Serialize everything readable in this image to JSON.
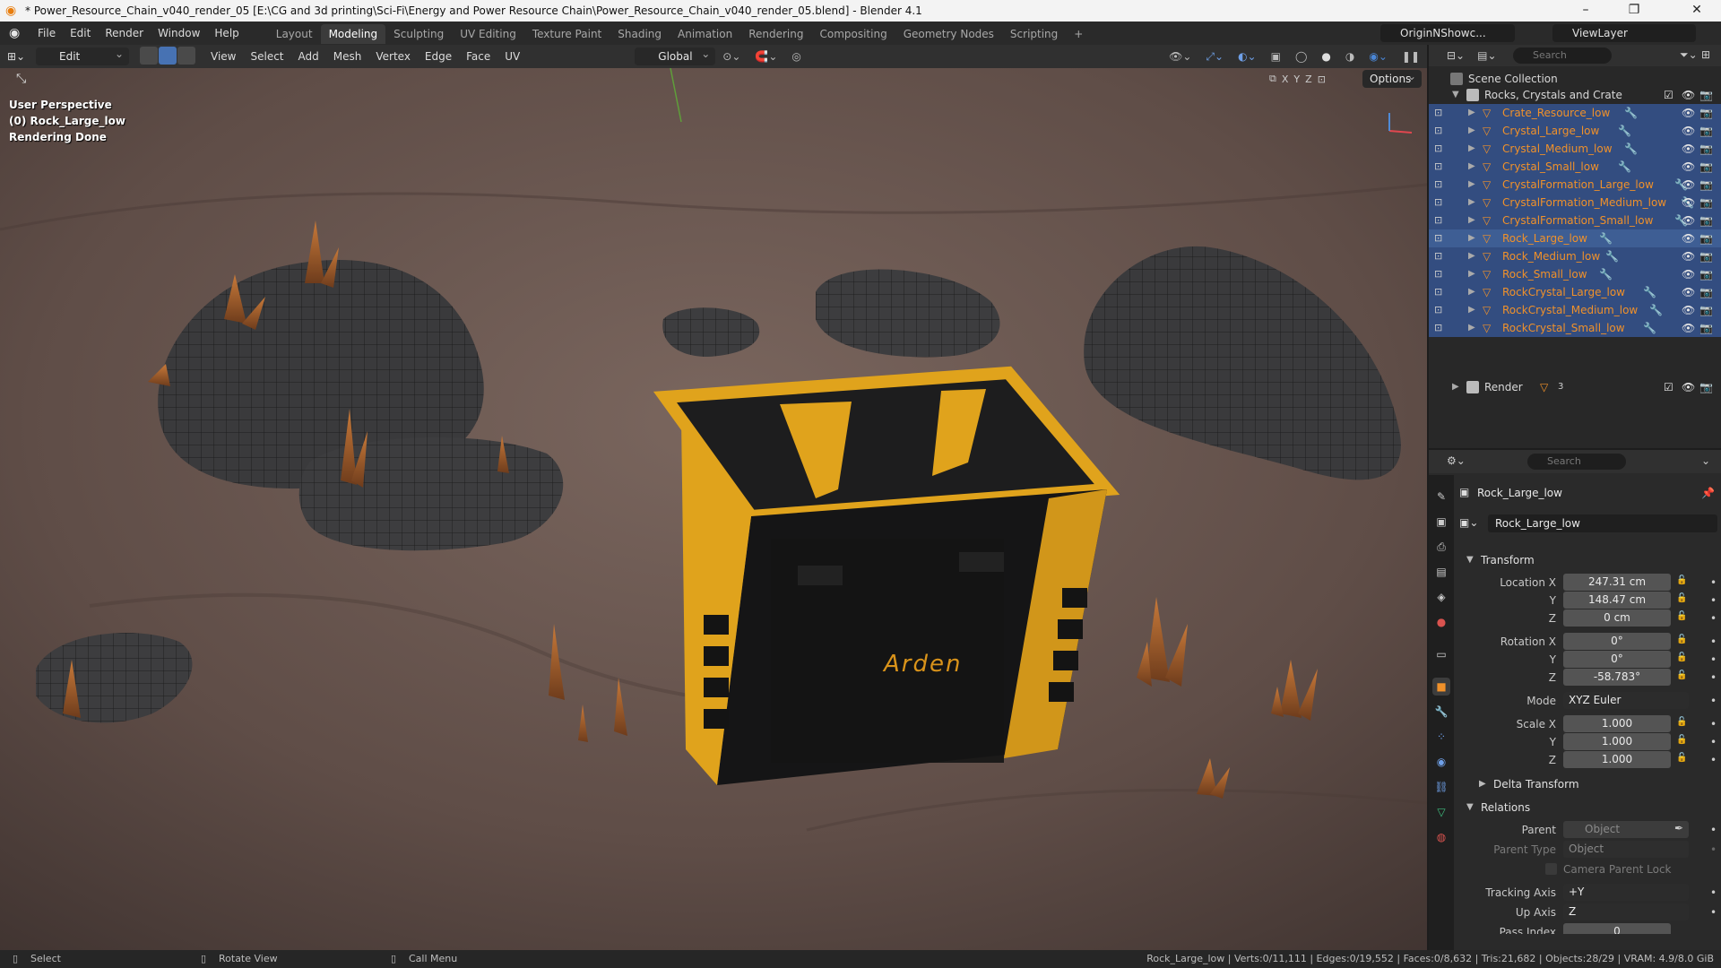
{
  "titlebar": {
    "title": "* Power_Resource_Chain_v040_render_05 [E:\\CG and 3d printing\\Sci-Fi\\Energy and Power Resource Chain\\Power_Resource_Chain_v040_render_05.blend] - Blender 4.1",
    "minimize": "–",
    "maximize": "❐",
    "close": "✕"
  },
  "menus": [
    "File",
    "Edit",
    "Render",
    "Window",
    "Help"
  ],
  "workspaces": [
    "Layout",
    "Modeling",
    "Sculpting",
    "UV Editing",
    "Texture Paint",
    "Shading",
    "Animation",
    "Rendering",
    "Compositing",
    "Geometry Nodes",
    "Scripting",
    "+"
  ],
  "active_workspace": "Modeling",
  "scene_name": "OriginNShowc...",
  "view_layer": "ViewLayer",
  "viewport_header": {
    "mode": "Edit Mode",
    "menus": [
      "View",
      "Select",
      "Add",
      "Mesh",
      "Vertex",
      "Edge",
      "Face",
      "UV"
    ],
    "transform_orientation": "Global",
    "options": "Options",
    "axes": [
      "X",
      "Y",
      "Z"
    ]
  },
  "viewport_info": {
    "perspective": "User Perspective",
    "object": "(0) Rock_Large_low",
    "status": "Rendering Done",
    "crate_logo": "Arden"
  },
  "outliner": {
    "search_placeholder": "Search",
    "scene_collection": "Scene Collection",
    "collection": "Rocks, Crystals and Crate",
    "objects": [
      "Crate_Resource_low",
      "Crystal_Large_low",
      "Crystal_Medium_low",
      "Crystal_Small_low",
      "CrystalFormation_Large_low",
      "CrystalFormation_Medium_low",
      "CrystalFormation_Small_low",
      "Rock_Large_low",
      "Rock_Medium_low",
      "Rock_Small_low",
      "RockCrystal_Large_low",
      "RockCrystal_Medium_low",
      "RockCrystal_Small_low"
    ],
    "active_object": "Rock_Large_low",
    "render_collection": "Render",
    "render_count": "3"
  },
  "properties": {
    "search_placeholder": "Search",
    "object_name": "Rock_Large_low",
    "name_field": "Rock_Large_low",
    "transform_label": "Transform",
    "location_label": "Location X",
    "location": [
      "247.31 cm",
      "148.47 cm",
      "0 cm"
    ],
    "rotation_label": "Rotation X",
    "rotation": [
      "0°",
      "0°",
      "-58.783°"
    ],
    "mode_label": "Mode",
    "mode": "XYZ Euler",
    "scale_label": "Scale X",
    "scale": [
      "1.000",
      "1.000",
      "1.000"
    ],
    "axis_y": "Y",
    "axis_z": "Z",
    "delta_transform": "Delta Transform",
    "relations": "Relations",
    "parent_label": "Parent",
    "parent_placeholder": "Object",
    "parent_type_label": "Parent Type",
    "parent_type": "Object",
    "camera_parent_lock": "Camera Parent Lock",
    "tracking_axis_label": "Tracking Axis",
    "tracking_axis": "+Y",
    "up_axis_label": "Up Axis",
    "up_axis": "Z",
    "pass_index_label": "Pass Index",
    "pass_index": "0"
  },
  "statusbar": {
    "select": "Select",
    "rotate": "Rotate View",
    "call_menu": "Call Menu",
    "stats": "Rock_Large_low | Verts:0/11,111 | Edges:0/19,552 | Faces:0/8,632 | Tris:21,682 | Objects:28/29 | VRAM: 4.9/8.0 GiB"
  },
  "colors": {
    "accent": "#4772b3",
    "selected_row": "#334d80",
    "object_text": "#f0912a",
    "crate_yellow": "#e0a31c",
    "ground": "#6a5750"
  }
}
